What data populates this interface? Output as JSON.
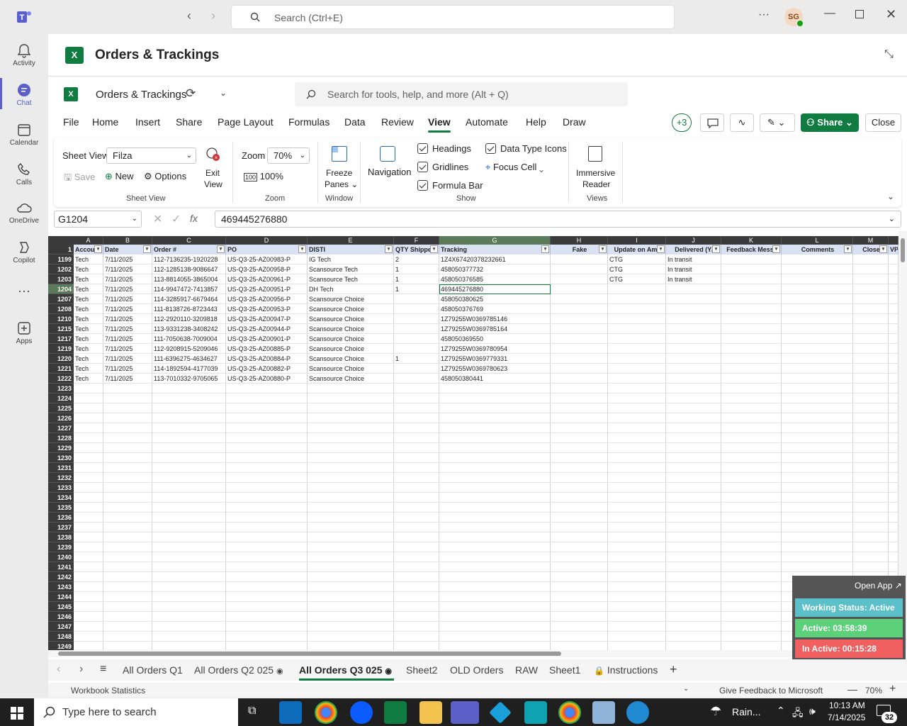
{
  "topbar": {
    "search_placeholder": "Search (Ctrl+E)",
    "avatar_initials": "SG",
    "more": "···"
  },
  "rail": [
    {
      "label": "Activity"
    },
    {
      "label": "Chat"
    },
    {
      "label": "Calendar"
    },
    {
      "label": "Calls"
    },
    {
      "label": "OneDrive"
    },
    {
      "label": "Copilot"
    },
    {
      "label": "···"
    },
    {
      "label": "Apps"
    }
  ],
  "app_header": {
    "title": "Orders & Trackings"
  },
  "workbook": {
    "name": "Orders & Trackings",
    "search_placeholder": "Search for tools, help, and more (Alt + Q)"
  },
  "ribbon_tabs": [
    "File",
    "Home",
    "Insert",
    "Share",
    "Page Layout",
    "Formulas",
    "Data",
    "Review",
    "View",
    "Automate",
    "Help",
    "Draw"
  ],
  "active_tab": "View",
  "ribbon_right": {
    "presence": "+3",
    "share": "Share",
    "close": "Close"
  },
  "ribbon": {
    "sheet_view": {
      "label": "Sheet View",
      "value": "Filza",
      "save": "Save",
      "new": "New",
      "options": "Options",
      "exit1": "Exit",
      "exit2": "View",
      "group": "Sheet View"
    },
    "zoom": {
      "label": "Zoom",
      "value": "70%",
      "hundred": "100%",
      "group": "Zoom"
    },
    "window": {
      "freeze1": "Freeze",
      "freeze2": "Panes",
      "group": "Window"
    },
    "navigation": "Navigation",
    "show": {
      "headings": "Headings",
      "gridlines": "Gridlines",
      "formula_bar": "Formula Bar",
      "data_type_icons": "Data Type Icons",
      "focus_cell": "Focus Cell",
      "group": "Show"
    },
    "views": {
      "imm1": "Immersive",
      "imm2": "Reader",
      "group": "Views"
    }
  },
  "formula_bar": {
    "name_box": "G1204",
    "fx": "fx",
    "value": "469445276880"
  },
  "sheet": {
    "columns": [
      {
        "l": "A",
        "h": "Accou"
      },
      {
        "l": "B",
        "h": "Date"
      },
      {
        "l": "C",
        "h": "Order #"
      },
      {
        "l": "D",
        "h": "PO"
      },
      {
        "l": "E",
        "h": "DISTI"
      },
      {
        "l": "F",
        "h": "QTY Shippe"
      },
      {
        "l": "G",
        "h": "Tracking"
      },
      {
        "l": "H",
        "h": "Fake"
      },
      {
        "l": "I",
        "h": "Update on Ama"
      },
      {
        "l": "J",
        "h": "Delivered (Y/"
      },
      {
        "l": "K",
        "h": "Feedback Messa"
      },
      {
        "l": "L",
        "h": "Comments"
      },
      {
        "l": "M",
        "h": "Close"
      },
      {
        "l": "",
        "h": "VP"
      }
    ],
    "header_row": "1",
    "rows": [
      {
        "n": "1199",
        "c": [
          "Tech",
          "7/11/2025",
          "112-7136235-1920228",
          "US-Q3-25-AZ00983-P",
          "IG Tech",
          "2",
          "1Z4X67420378232661",
          "",
          "CTG",
          "In transit"
        ]
      },
      {
        "n": "1202",
        "c": [
          "Tech",
          "7/11/2025",
          "112-1285138-9086647",
          "US-Q3-25-AZ00958-P",
          "Scansource Tech",
          "1",
          "458050377732",
          "",
          "CTG",
          "In transit"
        ]
      },
      {
        "n": "1203",
        "c": [
          "Tech",
          "7/11/2025",
          "113-8814055-3865004",
          "US-Q3-25-AZ00961-P",
          "Scansource Tech",
          "1",
          "458050376585",
          "",
          "CTG",
          "In transit"
        ]
      },
      {
        "n": "1204",
        "c": [
          "Tech",
          "7/11/2025",
          "114-9947472-7413857",
          "US-Q3-25-AZ00951-P",
          "DH Tech",
          "1",
          "469445276880",
          "",
          "",
          ""
        ]
      },
      {
        "n": "1207",
        "c": [
          "Tech",
          "7/11/2025",
          "114-3285917-6679464",
          "US-Q3-25-AZ00956-P",
          "Scansource Choice",
          "",
          "458050380625",
          "",
          "",
          ""
        ]
      },
      {
        "n": "1208",
        "c": [
          "Tech",
          "7/11/2025",
          "111-8138726-8723443",
          "US-Q3-25-AZ00953-P",
          "Scansource Choice",
          "",
          "458050376769",
          "",
          "",
          ""
        ]
      },
      {
        "n": "1210",
        "c": [
          "Tech",
          "7/11/2025",
          "112-2920110-3209818",
          "US-Q3-25-AZ00947-P",
          "Scansource Choice",
          "",
          "1Z79255W0369785146",
          "",
          "",
          ""
        ]
      },
      {
        "n": "1215",
        "c": [
          "Tech",
          "7/11/2025",
          "113-9331238-3408242",
          "US-Q3-25-AZ00944-P",
          "Scansource Choice",
          "",
          "1Z79255W0369785164",
          "",
          "",
          ""
        ]
      },
      {
        "n": "1217",
        "c": [
          "Tech",
          "7/11/2025",
          "111-7050638-7009004",
          "US-Q3-25-AZ00901-P",
          "Scansource Choice",
          "",
          "458050369550",
          "",
          "",
          ""
        ]
      },
      {
        "n": "1219",
        "c": [
          "Tech",
          "7/11/2025",
          "112-9208915-5209046",
          "US-Q3-25-AZ00885-P",
          "Scansource Choice",
          "",
          "1Z79255W0369780954",
          "",
          "",
          ""
        ]
      },
      {
        "n": "1220",
        "c": [
          "Tech",
          "7/11/2025",
          "111-6396275-4634627",
          "US-Q3-25-AZ00884-P",
          "Scansource Choice",
          "1",
          "1Z79255W0369779331",
          "",
          "",
          ""
        ]
      },
      {
        "n": "1221",
        "c": [
          "Tech",
          "7/11/2025",
          "114-1892594-4177039",
          "US-Q3-25-AZ00882-P",
          "Scansource Choice",
          "",
          "1Z79255W0369780623",
          "",
          "",
          ""
        ]
      },
      {
        "n": "1222",
        "c": [
          "Tech",
          "7/11/2025",
          "113-7010332-9705065",
          "US-Q3-25-AZ00880-P",
          "Scansource Choice",
          "",
          "458050380441",
          "",
          "",
          ""
        ]
      }
    ],
    "empty_rows": [
      "1223",
      "1224",
      "1225",
      "1226",
      "1227",
      "1228",
      "1229",
      "1230",
      "1231",
      "1232",
      "1233",
      "1234",
      "1235",
      "1236",
      "1237",
      "1238",
      "1239",
      "1240",
      "1241",
      "1242",
      "1243",
      "1244",
      "1245",
      "1246",
      "1247",
      "1248",
      "1249"
    ]
  },
  "sheet_tabs": [
    "All Orders Q1",
    "All Orders Q2 025",
    "All Orders Q3 025",
    "Sheet2",
    "OLD Orders",
    "RAW",
    "Sheet1",
    "Instructions"
  ],
  "status": {
    "left": "Workbook Statistics",
    "feedback": "Give Feedback to Microsoft",
    "zoom": "70%"
  },
  "overlay": {
    "open_app": "Open App ↗",
    "working": "Working Status: Active",
    "active": "Active: 03:58:39",
    "inactive": "In Active: 00:15:28"
  },
  "taskbar": {
    "search": "Type here to search",
    "weather": "Rain...",
    "time": "10:13 AM",
    "date": "7/14/2025",
    "notif": "32"
  },
  "colors": {
    "excel_green": "#107c41",
    "teams_purple": "#5b5fc7",
    "header_fill": "#d9e1f2",
    "working": "#5bc0c8",
    "active": "#5cd17a",
    "inactive": "#f06060"
  }
}
